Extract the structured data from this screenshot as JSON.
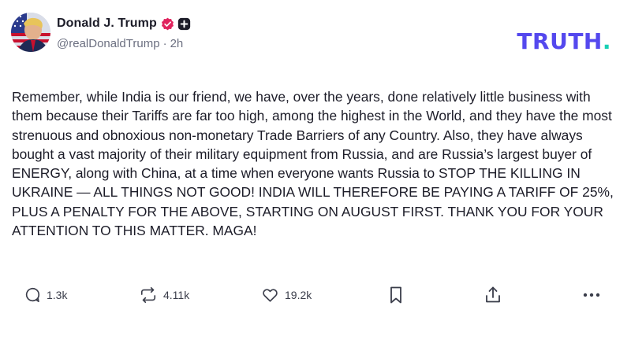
{
  "author": {
    "display_name": "Donald J. Trump",
    "handle": "@realDonaldTrump",
    "separator": "·",
    "timestamp": "2h",
    "avatar": "avatar-flag-portrait",
    "verified_icon": "verified-check-icon",
    "badge_icon": "plus-badge-icon"
  },
  "brand": {
    "logo_text": "TRUTH",
    "logo_dot": ".",
    "color": "#5448ee",
    "dot_color": "#18d0b4"
  },
  "post": {
    "text": "Remember, while India is our friend, we have, over the years, done relatively little business with them because their Tariffs are far too high, among the highest in the World, and they have the most strenuous and obnoxious non-monetary Trade Barriers of any Country. Also, they have always bought a vast majority of their military equipment from Russia, and are Russia’s largest buyer of ENERGY, along with China, at a time when everyone wants Russia to STOP THE KILLING IN UKRAINE — ALL THINGS NOT GOOD! INDIA WILL THEREFORE BE PAYING A TARIFF OF 25%, PLUS A PENALTY FOR THE ABOVE, STARTING ON AUGUST FIRST. THANK YOU FOR YOUR ATTENTION TO THIS MATTER. MAGA!"
  },
  "actions": {
    "reply": {
      "icon": "reply-icon",
      "count": "1.3k"
    },
    "retruth": {
      "icon": "retruth-icon",
      "count": "4.11k"
    },
    "like": {
      "icon": "heart-icon",
      "count": "19.2k"
    },
    "bookmark": {
      "icon": "bookmark-icon"
    },
    "share": {
      "icon": "share-icon"
    },
    "more": {
      "icon": "more-icon"
    }
  }
}
